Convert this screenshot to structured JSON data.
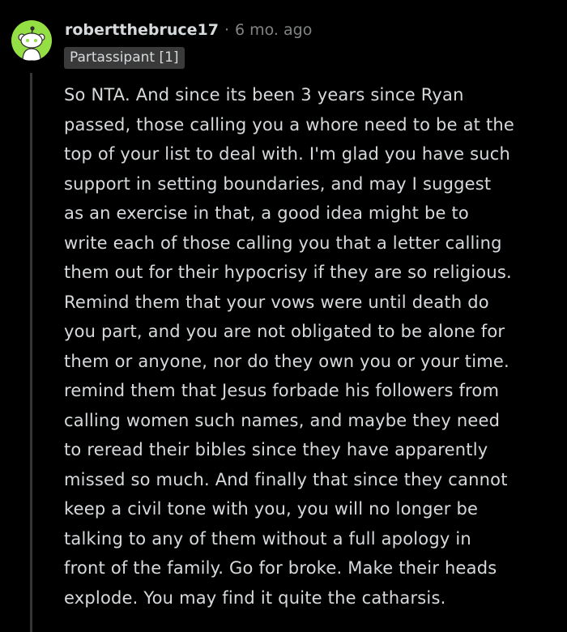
{
  "comment": {
    "author": "robertthebruce17",
    "separator": "·",
    "timestamp": "6 mo. ago",
    "flair": "Partassipant [1]",
    "avatar_icon": "snoo-avatar-icon",
    "body_lines": [
      "So NTA. And since its been 3 years since Ryan",
      "passed, those calling you a whore need to be at the",
      "top of your list to deal with. I'm glad you have such",
      "support in setting boundaries, and may I suggest",
      "as an exercise in that, a good idea might be to",
      "write each of those calling you that a letter calling",
      "them out for their hypocrisy if they are so religious.",
      "Remind them that your vows were until death do",
      "you part, and you are not obligated to be alone for",
      "them or anyone, nor do they own you or your time.",
      "remind them that Jesus forbade his followers from",
      "calling women such names, and maybe they need",
      "to reread their bibles since they have apparently",
      "missed so much. And finally that since they cannot",
      "keep a civil tone with you, you will no longer be",
      "talking to any of them without a full apology in",
      "front of the family. Go for broke. Make their heads",
      "explode. You may find it quite the catharsis."
    ]
  },
  "colors": {
    "background": "#000000",
    "text": "#d7dadc",
    "muted": "#818384",
    "avatar_bg": "#94e044",
    "flair_bg": "#3a3a3a",
    "thread_line": "#343536"
  }
}
